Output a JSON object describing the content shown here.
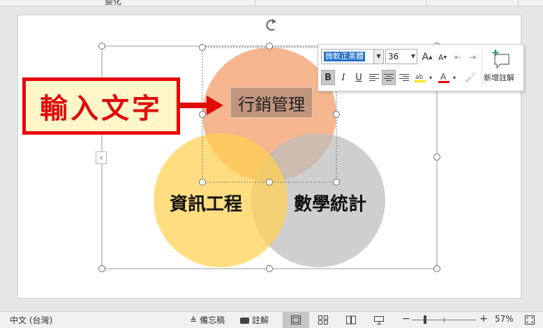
{
  "top_strip": {
    "partial_label": "變化"
  },
  "callout": {
    "text": "輸入文字",
    "border_color": "#e8060c",
    "fill_color": "#fff6c9"
  },
  "venn": {
    "circles": [
      {
        "label": "行銷管理",
        "color": "#f4a97c"
      },
      {
        "label": "資訊工程",
        "color": "#ffd36a"
      },
      {
        "label": "數學統計",
        "color": "#c8c8c8"
      }
    ]
  },
  "mini_toolbar": {
    "font_name": "微軟正黑體",
    "font_size": "36",
    "grow_font_icon": "increase-font-size-icon",
    "shrink_font_icon": "decrease-font-size-icon",
    "buttons": {
      "bold": "B",
      "italic": "I",
      "underline": "U"
    },
    "new_comment_label": "新增註解"
  },
  "status_bar": {
    "language": "中文 (台灣)",
    "notes_label": "備忘稿",
    "comments_label": "註解",
    "zoom_minus": "−",
    "zoom_plus": "+",
    "zoom_level": "57%"
  }
}
